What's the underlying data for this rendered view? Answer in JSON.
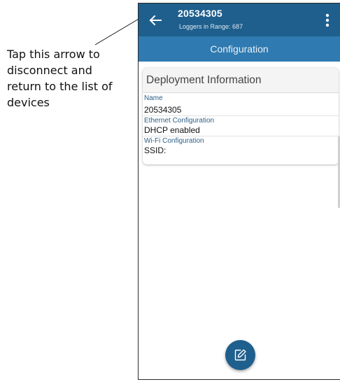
{
  "annotation": {
    "back_arrow_note": "Tap this arrow to disconnect and return to the list of devices"
  },
  "appbar": {
    "title": "20534305",
    "subtitle": "Loggers in Range: 687",
    "back_icon": "arrow-left-icon",
    "menu_icon": "more-vertical-icon"
  },
  "tab": {
    "label": "Configuration"
  },
  "card": {
    "heading": "Deployment Information",
    "fields": [
      {
        "label": "Name",
        "value": "20534305"
      },
      {
        "label": "Ethernet Configuration",
        "value": "DHCP enabled"
      },
      {
        "label": "Wi-Fi Configuration",
        "value": "SSID:"
      }
    ]
  },
  "fab": {
    "icon": "edit-icon"
  },
  "colors": {
    "appbar": "#1f5f8d",
    "tabbar": "#2f7ab0",
    "field_label": "#2c5f87"
  }
}
